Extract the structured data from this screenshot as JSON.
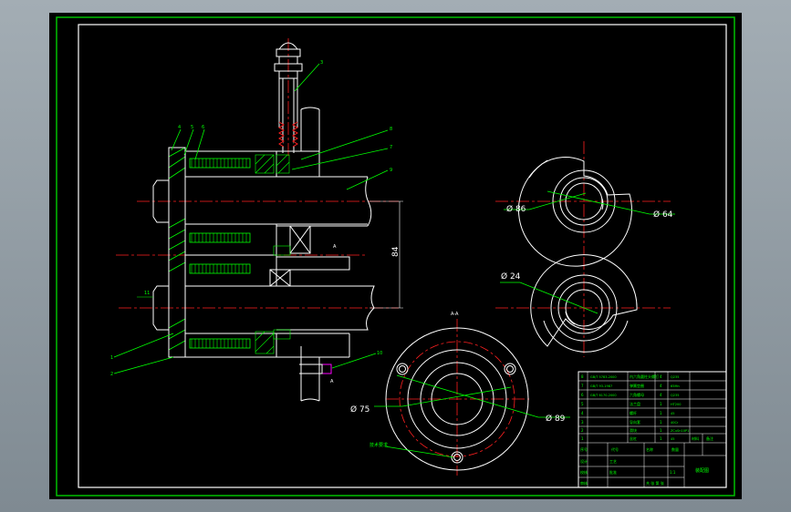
{
  "drawing": {
    "colors": {
      "background": "#000000",
      "viewport": "#8c979f",
      "outline": "#ffffff",
      "leader": "#00ff00",
      "centerline": "#ff0000",
      "hatch": "#00ff00",
      "dimension": "#ffffff",
      "small_part": "#ff00ff"
    },
    "dimensions": {
      "d84_vertical": "84",
      "d86": "Ø 86",
      "d64": "Ø 64",
      "d24": "Ø 24",
      "d75": "Ø 75",
      "d89": "Ø 89"
    },
    "balloons": [
      "3",
      "4",
      "5",
      "6",
      "8",
      "7",
      "9",
      "10",
      "1",
      "2",
      "11"
    ],
    "section_marks": {
      "a_a_top": "A-A",
      "a_arrow": "A"
    },
    "title_block": {
      "row_labels": [
        "8",
        "7",
        "6",
        "5",
        "4",
        "3",
        "2",
        "1"
      ],
      "left_codes": [
        "GB/T 5783-2000",
        "GB/T 93-1987",
        "GB/T 6170-2000",
        "",
        "",
        "",
        "",
        ""
      ],
      "middle_names": [
        "内六角圆柱头螺钉",
        "弹簧垫圈",
        "六角螺母",
        "法兰盘",
        "螺杆",
        "导向套",
        "滑块",
        "丝杠"
      ],
      "qty": [
        "4",
        "4",
        "4",
        "1",
        "1",
        "1",
        "1",
        "1"
      ],
      "material": [
        "Q235",
        "65Mn",
        "Q235",
        "HT200",
        "45",
        "40Cr",
        "ZCuSn10P1",
        "45"
      ],
      "header": [
        "序号",
        "代号",
        "名称",
        "数量",
        "材料",
        "备注"
      ],
      "sign": [
        "设计",
        "校核",
        "审核",
        "工艺",
        "批准"
      ],
      "right_title": "装配图",
      "scale": "1:1",
      "sheet": "共 张 第 张"
    },
    "note_block": "技术要求"
  }
}
